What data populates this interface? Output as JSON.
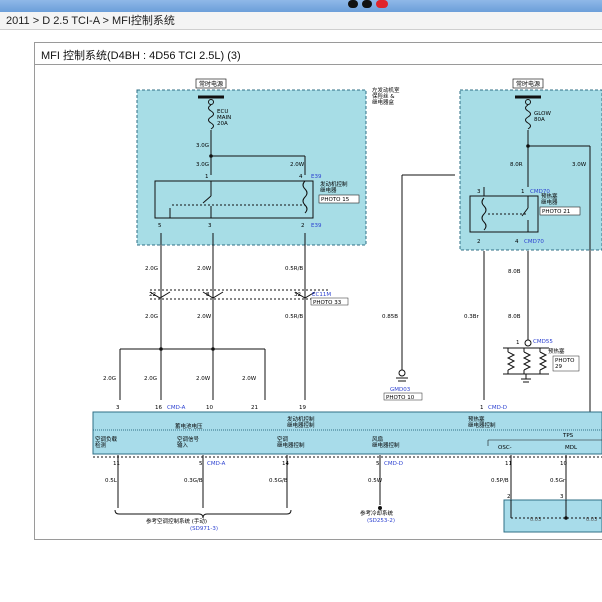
{
  "breadcrumb": "2011 > D 2.5 TCI-A > MFI控制系统",
  "diagram_title": "MFI 控制系统(D4BH : 4D56 TCI 2.5L) (3)",
  "colors": {
    "shaded_box": "#a7dde6",
    "box_border": "#2f6f86",
    "module_fill": "#a8dcea",
    "blue_text": "#2a3fd0"
  },
  "box_left": {
    "power": "常时电源",
    "fuse_name": "ECU MAIN 20A",
    "side_note": "左发动机室 保险丝 & 继电器盒",
    "relay_label": "发动机控制 继电器",
    "relay_photo": "PHOTO 15",
    "conn_top": "E39",
    "conn_bottom": "E39",
    "pins": {
      "p1": "1",
      "p4": "4",
      "p5": "5",
      "p3": "3",
      "p2": "2"
    },
    "wires": {
      "w_top": "3.0G",
      "w_g": "3.0G",
      "w_w": "2.0W"
    }
  },
  "box_right": {
    "power": "常时电源",
    "fuse_name": "GLOW 80A",
    "relay_label": "预热塞 继电器",
    "relay_photo": "PHOTO 21",
    "conn_top": "CMD70",
    "conn_bottom": "CMD70",
    "pins": {
      "p3": "3",
      "p1": "1",
      "p2": "2",
      "p4": "4"
    },
    "wires": {
      "w_r": "8.0R",
      "w_w": "3.0W"
    }
  },
  "mid_wires": {
    "a": "2.0G",
    "b": "2.0W",
    "c": "0.5R/B",
    "d": "2.0G",
    "e": "2.0W",
    "f": "0.5R/B",
    "g": "0.85B",
    "h": "0.3Br",
    "i": "8.0B",
    "j": "8.0B"
  },
  "mid_conn": {
    "p22": "22",
    "p8": "8",
    "p32": "32",
    "name": "EC11M",
    "photo": "PHOTO 33"
  },
  "ground": {
    "name": "GMD03",
    "photo": "PHOTO 10"
  },
  "glow": {
    "conn": "CMD55",
    "label": "预热塞",
    "photo": "PHOTO 29",
    "pin": "1"
  },
  "lower_wires": {
    "a": "2.0G",
    "b": "2.0G",
    "c": "2.0W",
    "d": "2.0W"
  },
  "module": {
    "pins_top": {
      "p3": "3",
      "p16": "16",
      "p10": "10",
      "p21": "21",
      "p19": "19",
      "p1": "1"
    },
    "conn_a": "CMD-A",
    "conn_d": "CMD-D",
    "labels": [
      "蓄电池电压",
      "发动机控制 继电器控制",
      "预热塞 继电器控制"
    ],
    "bottom_labels": [
      "空调负载 检测",
      "空调信号 输入",
      "空调 继电器控制",
      "风扇 继电器控制",
      "OSC-",
      "MDL"
    ],
    "tps": "TPS",
    "pins_bottom": {
      "p11": "11",
      "p5a": "5",
      "p14": "14",
      "p5d": "5",
      "p11b": "11",
      "p10": "10"
    },
    "conn_a2": "CMD-A",
    "conn_d2": "CMD-D"
  },
  "bottom_wires": {
    "a": "0.5L",
    "b": "0.3G/B",
    "c": "0.5G/B",
    "d": "0.5W",
    "e": "0.5P/B",
    "f": "0.5Gr"
  },
  "refs": {
    "ac": "参考空调控制系统 (手动)",
    "ac_code": "(SD971-3)",
    "cool": "参考冷却系统",
    "cool_code": "(SD253-2)",
    "pins": {
      "p2": "2",
      "p3": "3"
    },
    "dash": {
      "a": "0.03",
      "b": "0.03"
    }
  }
}
